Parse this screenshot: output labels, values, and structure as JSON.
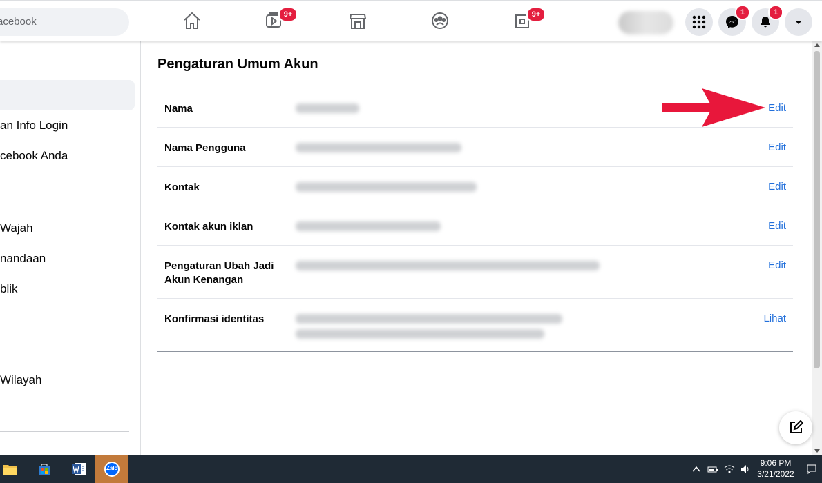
{
  "browser": {
    "search_placeholder": "acebook"
  },
  "nav": {
    "watch_badge": "9+",
    "pages_badge": "9+",
    "messenger_badge": "1",
    "notifications_badge": "1"
  },
  "sidebar": {
    "items": [
      {
        "label": "an Info Login"
      },
      {
        "label": "cebook Anda"
      },
      {
        "label": "Wajah"
      },
      {
        "label": "nandaan"
      },
      {
        "label": "blik"
      },
      {
        "label": "Wilayah"
      }
    ]
  },
  "settings": {
    "heading": "Pengaturan Umum Akun",
    "rows": [
      {
        "label": "Nama",
        "action": "Edit"
      },
      {
        "label": "Nama Pengguna",
        "action": "Edit"
      },
      {
        "label": "Kontak",
        "action": "Edit"
      },
      {
        "label": "Kontak akun iklan",
        "action": "Edit"
      },
      {
        "label": "Pengaturan Ubah Jadi Akun Kenangan",
        "action": "Edit"
      },
      {
        "label": "Konfirmasi identitas",
        "action": "Lihat"
      }
    ]
  },
  "taskbar": {
    "zalo_label": "Zalo",
    "time": "9:06 PM",
    "date": "3/21/2022"
  },
  "colors": {
    "link": "#216fdb",
    "badge": "#e41e3f",
    "arrow": "#e8173b",
    "taskbar": "#1f2a35"
  }
}
